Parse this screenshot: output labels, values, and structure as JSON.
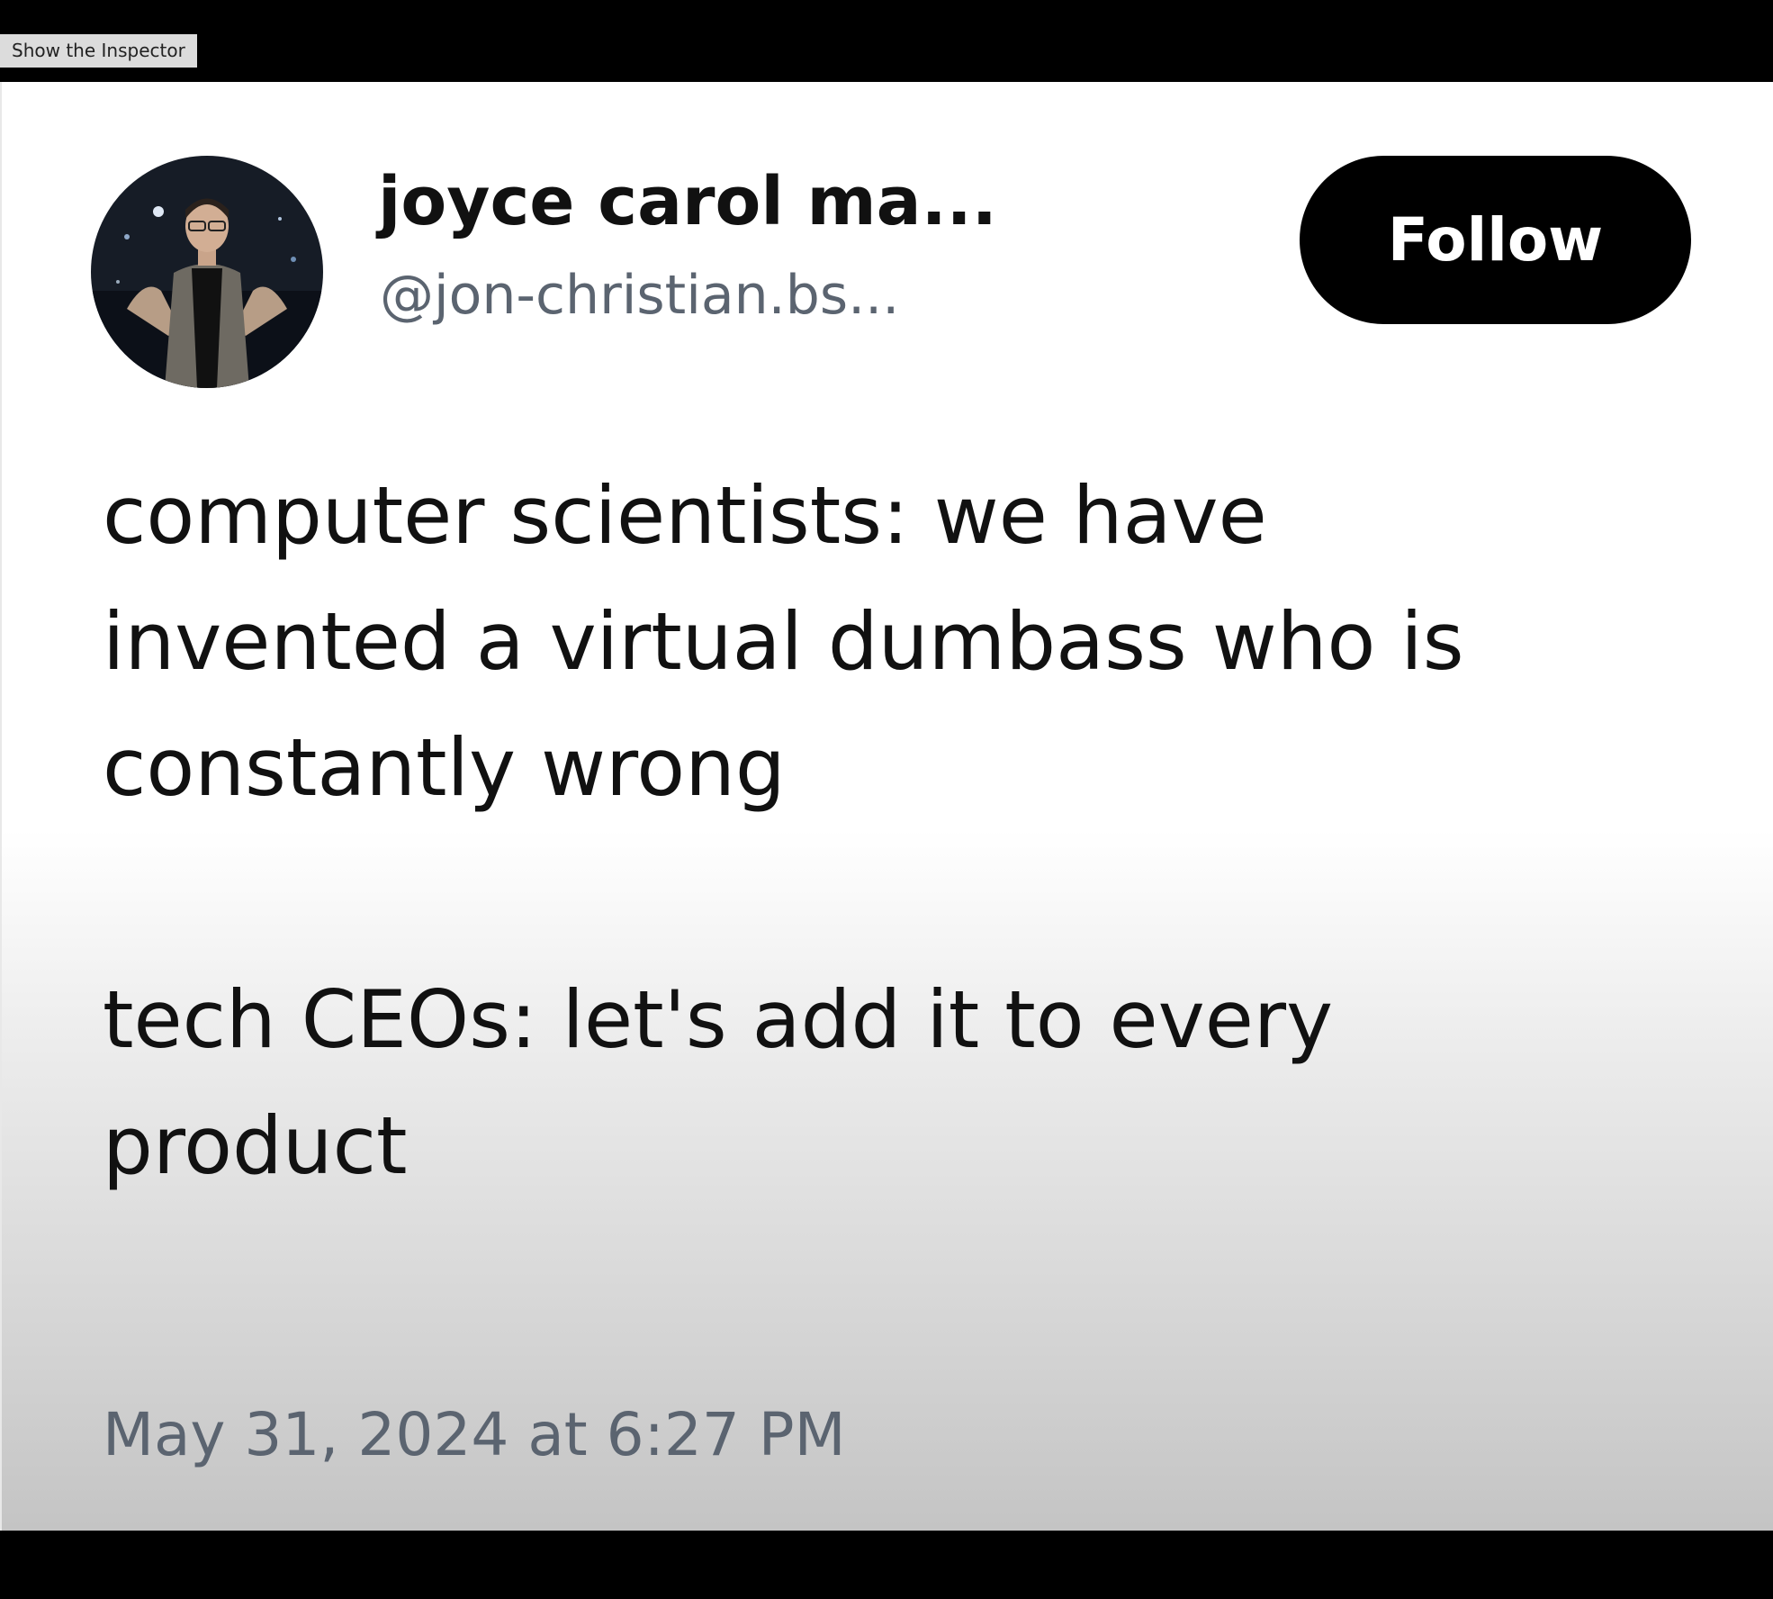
{
  "inspector": {
    "label": "Show the Inspector"
  },
  "post": {
    "author": {
      "display_name": "joyce carol ma...",
      "handle": "@jon-christian.bs..."
    },
    "follow_label": "Follow",
    "text_lines": [
      "computer scientists: we have",
      "invented a virtual dumbass who is",
      "constantly wrong",
      "",
      "tech CEOs: let's add it to every",
      "product"
    ],
    "timestamp": "May 31, 2024 at 6:27 PM"
  },
  "colors": {
    "frame_black": "#000000",
    "text_primary": "#111111",
    "text_secondary": "#5b6470",
    "follow_bg": "#000000",
    "follow_text": "#ffffff"
  }
}
